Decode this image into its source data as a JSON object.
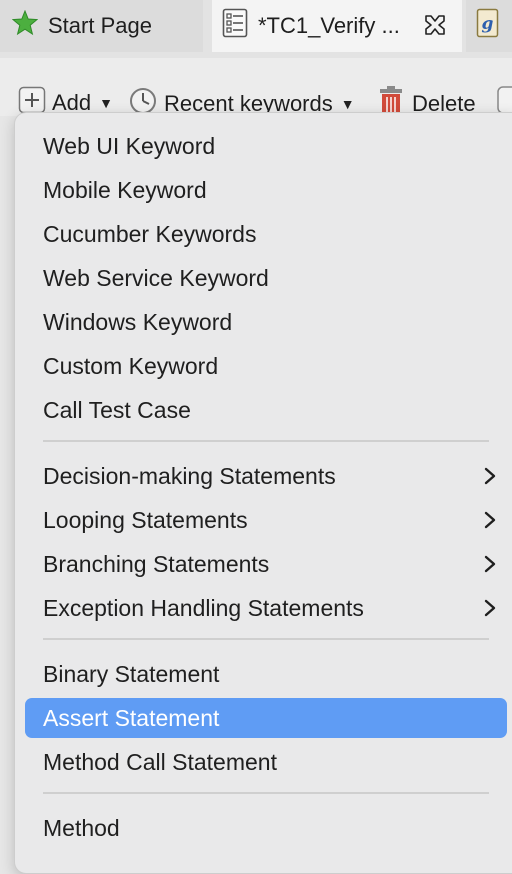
{
  "tabs": [
    {
      "label": "Start Page",
      "icon": "star-icon"
    },
    {
      "label": "*TC1_Verify ...",
      "icon": "test-case-icon"
    },
    {
      "label": "",
      "icon": "groovy-script-icon"
    }
  ],
  "toolbar": {
    "add_label": "Add",
    "recent_label": "Recent keywords",
    "delete_label": "Delete"
  },
  "menu": {
    "group1": [
      "Web UI Keyword",
      "Mobile Keyword",
      "Cucumber Keywords",
      "Web Service Keyword",
      "Windows Keyword",
      "Custom Keyword",
      "Call Test Case"
    ],
    "group2": [
      "Decision-making Statements",
      "Looping Statements",
      "Branching Statements",
      "Exception Handling Statements"
    ],
    "group3": [
      "Binary Statement",
      "Assert Statement",
      "Method Call Statement"
    ],
    "group4": [
      "Method"
    ],
    "highlighted": "Assert Statement",
    "highlight_color": "#5f9cf4"
  }
}
